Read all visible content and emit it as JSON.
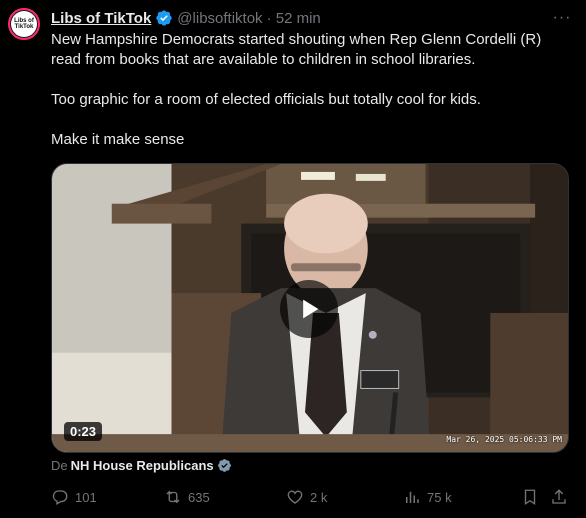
{
  "author": {
    "avatar_text": "Libs of TikTok",
    "name": "Libs of TikTok",
    "handle": "@libsoftiktok",
    "time": "· 52 min",
    "more_icon": "more-dots-icon"
  },
  "post": {
    "text": "New Hampshire Democrats started shouting when Rep Glenn Cordelli (R) read from books that are available to children in school libraries.\n\nToo graphic for a room of elected officials but totally cool for kids.\n\nMake it make sense"
  },
  "media": {
    "duration": "0:23",
    "timestamp": "Mar 26, 2025 05:06:33 PM",
    "play_icon": "play-icon"
  },
  "attribution": {
    "prefix": "De",
    "source": "NH House Republicans"
  },
  "actions": {
    "replies": "101",
    "reposts": "635",
    "likes": "2 k",
    "views": "75 k"
  },
  "colors": {
    "background": "#000000",
    "text": "#e7e9ea",
    "muted": "#71767b",
    "verified": "#1d9bf0"
  }
}
